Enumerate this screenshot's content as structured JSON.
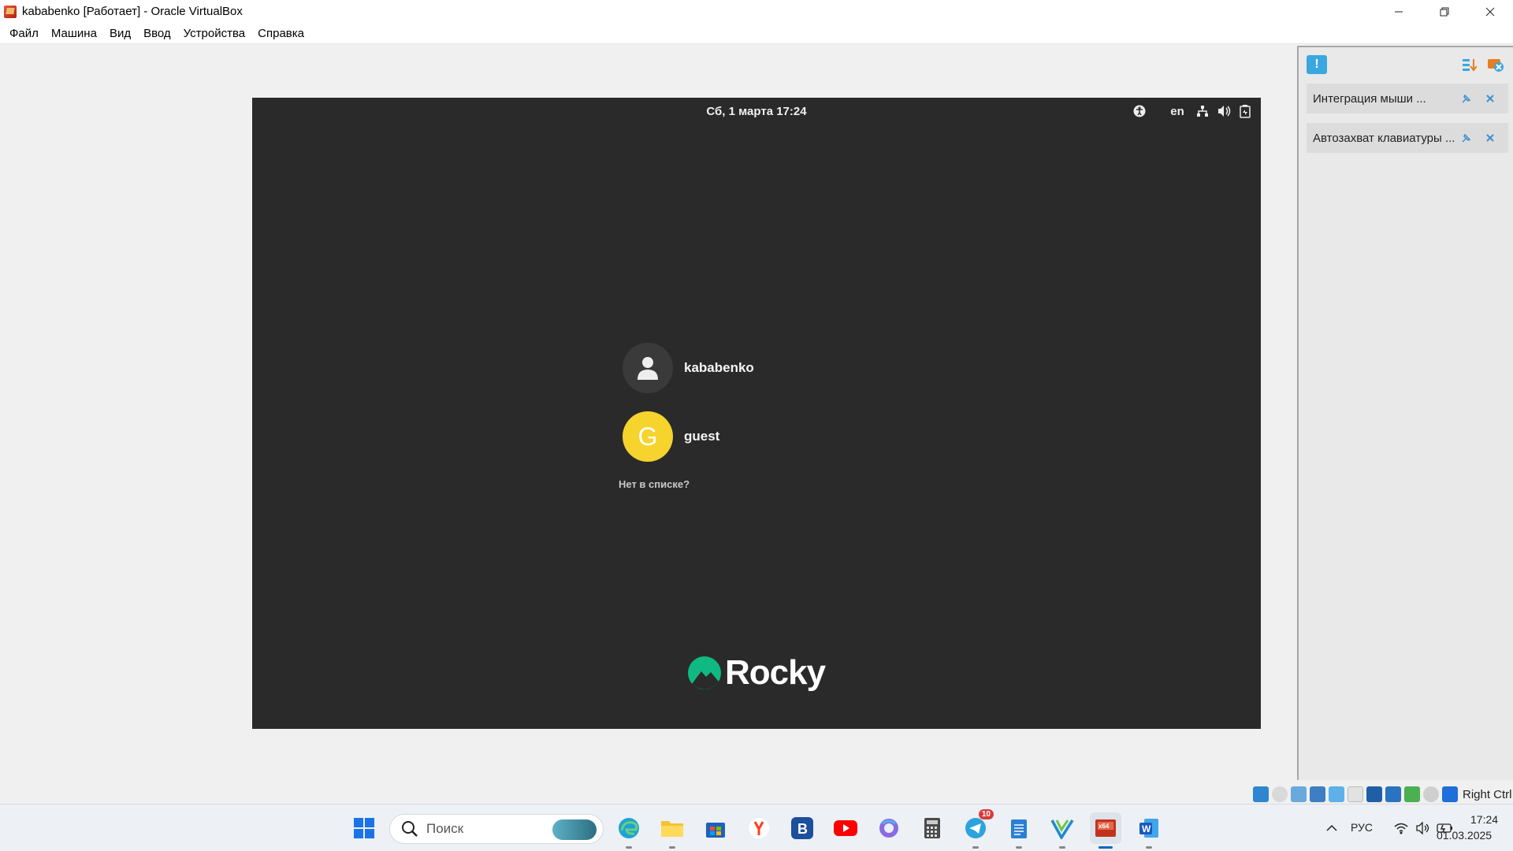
{
  "window": {
    "title": "kababenko [Работает] - Oracle VirtualBox",
    "controls": [
      "minimize",
      "restore",
      "close"
    ]
  },
  "menubar": {
    "items": [
      "Файл",
      "Машина",
      "Вид",
      "Ввод",
      "Устройства",
      "Справка"
    ]
  },
  "vm": {
    "topbar": {
      "datetime": "Сб, 1 марта  17:24",
      "keyboard_layout": "en",
      "icons": [
        "accessibility-icon",
        "network-icon",
        "volume-icon",
        "battery-icon"
      ]
    },
    "users": [
      {
        "name": "kababenko",
        "avatar": "person-icon"
      },
      {
        "name": "guest",
        "avatar_letter": "G",
        "avatar_color": "#f6d32d"
      }
    ],
    "not_listed": "Нет в списке?",
    "logo_text": "Rocky",
    "colors": {
      "background": "#2a2a2a",
      "logo_green": "#10b981"
    }
  },
  "notifications": {
    "items": [
      {
        "text": "Интеграция мыши ..."
      },
      {
        "text": "Автозахват клавиатуры ..."
      }
    ]
  },
  "statusbar": {
    "host_key": "Right Ctrl"
  },
  "taskbar": {
    "search_placeholder": "Поиск",
    "apps": [
      "windows-start",
      "edge",
      "file-explorer",
      "microsoft-store",
      "yandex-browser",
      "vk",
      "youtube",
      "copilot",
      "calculator",
      "telegram",
      "notepad",
      "vscode",
      "virtualbox",
      "word"
    ],
    "telegram_badge": "10",
    "language": "РУС",
    "time": "17:24",
    "date": "01.03.2025"
  }
}
